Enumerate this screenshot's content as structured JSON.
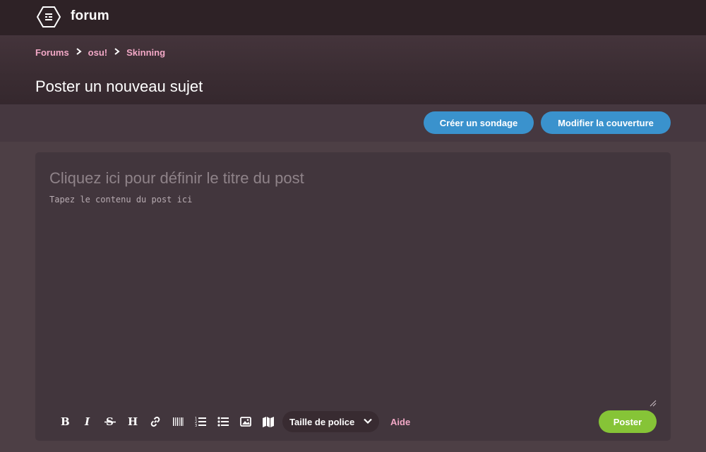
{
  "app": {
    "title": "forum"
  },
  "breadcrumb": {
    "items": [
      "Forums",
      "osu!",
      "Skinning"
    ]
  },
  "page": {
    "title": "Poster un nouveau sujet"
  },
  "actions": {
    "create_poll_label": "Créer un sondage",
    "edit_cover_label": "Modifier la couverture"
  },
  "editor": {
    "title_placeholder": "Cliquez ici pour définir le titre du post",
    "body_placeholder": "Tapez le contenu du post ici",
    "toolbar": {
      "buttons": [
        "bold-icon",
        "italic-icon",
        "strikethrough-icon",
        "heading-icon",
        "link-icon",
        "spoiler-icon",
        "ordered-list-icon",
        "unordered-list-icon",
        "image-icon",
        "map-icon"
      ],
      "font_size_label": "Taille de police",
      "help_label": "Aide"
    },
    "submit_label": "Poster"
  },
  "colors": {
    "accent_blue": "#3a92cd",
    "accent_green": "#86c437",
    "link_pink": "#f2a8c6",
    "topbar": "#2e2226",
    "background": "#4d3f45"
  }
}
